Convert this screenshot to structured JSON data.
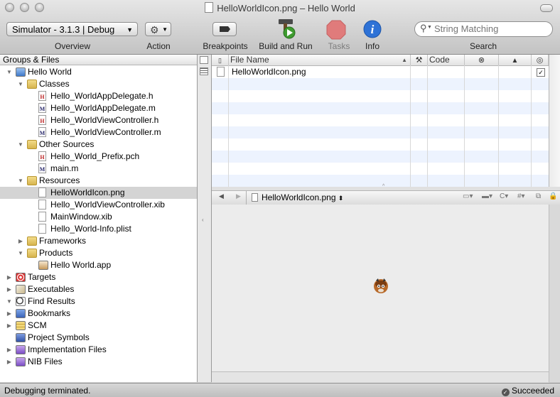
{
  "window": {
    "title": "HelloWorldIcon.png – Hello World"
  },
  "toolbar": {
    "overview_popup": "Simulator - 3.1.3 | Debug",
    "overview_label": "Overview",
    "action_label": "Action",
    "breakpoints_label": "Breakpoints",
    "build_run_label": "Build and Run",
    "tasks_label": "Tasks",
    "info_label": "Info",
    "search_placeholder": "String Matching",
    "search_label": "Search"
  },
  "groups_panel": {
    "header": "Groups & Files",
    "items": [
      {
        "label": "Hello World",
        "depth": 0,
        "expanded": true,
        "icon": "project-icon"
      },
      {
        "label": "Classes",
        "depth": 1,
        "expanded": true,
        "icon": "folder-icon"
      },
      {
        "label": "Hello_WorldAppDelegate.h",
        "depth": 2,
        "icon": "header-file-icon"
      },
      {
        "label": "Hello_WorldAppDelegate.m",
        "depth": 2,
        "icon": "source-file-icon"
      },
      {
        "label": "Hello_WorldViewController.h",
        "depth": 2,
        "icon": "header-file-icon"
      },
      {
        "label": "Hello_WorldViewController.m",
        "depth": 2,
        "icon": "source-file-icon"
      },
      {
        "label": "Other Sources",
        "depth": 1,
        "expanded": true,
        "icon": "folder-icon"
      },
      {
        "label": "Hello_World_Prefix.pch",
        "depth": 2,
        "icon": "header-file-icon"
      },
      {
        "label": "main.m",
        "depth": 2,
        "icon": "source-file-icon"
      },
      {
        "label": "Resources",
        "depth": 1,
        "expanded": true,
        "icon": "folder-icon"
      },
      {
        "label": "HelloWorldIcon.png",
        "depth": 2,
        "icon": "image-file-icon",
        "selected": true
      },
      {
        "label": "Hello_WorldViewController.xib",
        "depth": 2,
        "icon": "xib-file-icon"
      },
      {
        "label": "MainWindow.xib",
        "depth": 2,
        "icon": "xib-file-icon"
      },
      {
        "label": "Hello_World-Info.plist",
        "depth": 2,
        "icon": "plist-file-icon"
      },
      {
        "label": "Frameworks",
        "depth": 1,
        "expanded": false,
        "icon": "folder-icon"
      },
      {
        "label": "Products",
        "depth": 1,
        "expanded": true,
        "icon": "folder-icon"
      },
      {
        "label": "Hello World.app",
        "depth": 2,
        "icon": "app-icon"
      },
      {
        "label": "Targets",
        "depth": 0,
        "expanded": false,
        "icon": "targets-icon"
      },
      {
        "label": "Executables",
        "depth": 0,
        "expanded": false,
        "icon": "executables-icon"
      },
      {
        "label": "Find Results",
        "depth": 0,
        "expanded": true,
        "icon": "magnifier-icon"
      },
      {
        "label": "Bookmarks",
        "depth": 0,
        "expanded": false,
        "icon": "bookmarks-icon"
      },
      {
        "label": "SCM",
        "depth": 0,
        "expanded": false,
        "icon": "scm-icon"
      },
      {
        "label": "Project Symbols",
        "depth": 0,
        "icon": "symbols-icon"
      },
      {
        "label": "Implementation Files",
        "depth": 0,
        "expanded": false,
        "icon": "smart-group-icon"
      },
      {
        "label": "NIB Files",
        "depth": 0,
        "expanded": false,
        "icon": "smart-group-icon"
      }
    ]
  },
  "file_table": {
    "columns": {
      "file_name": "File Name",
      "code": "Code"
    },
    "rows": [
      {
        "file_name": "HelloWorldIcon.png",
        "checked": true
      }
    ]
  },
  "editor": {
    "file_popup": "HelloWorldIcon.png"
  },
  "status": {
    "message": "Debugging terminated.",
    "result": "Succeeded"
  }
}
